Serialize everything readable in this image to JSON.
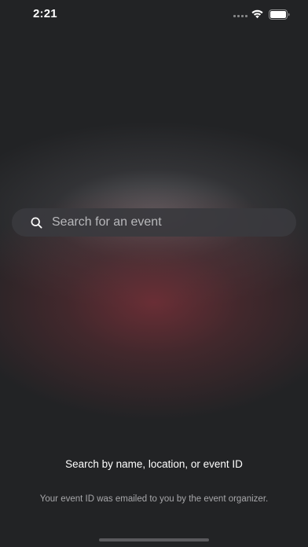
{
  "status_bar": {
    "time": "2:21"
  },
  "search": {
    "placeholder": "Search for an event",
    "value": ""
  },
  "help": {
    "title": "Search by name, location, or event ID",
    "subtitle": "Your event ID was emailed to you by the event organizer."
  },
  "icons": {
    "search": "search-icon",
    "wifi": "wifi-icon",
    "battery": "battery-icon",
    "signal": "cellular-signal-icon"
  }
}
